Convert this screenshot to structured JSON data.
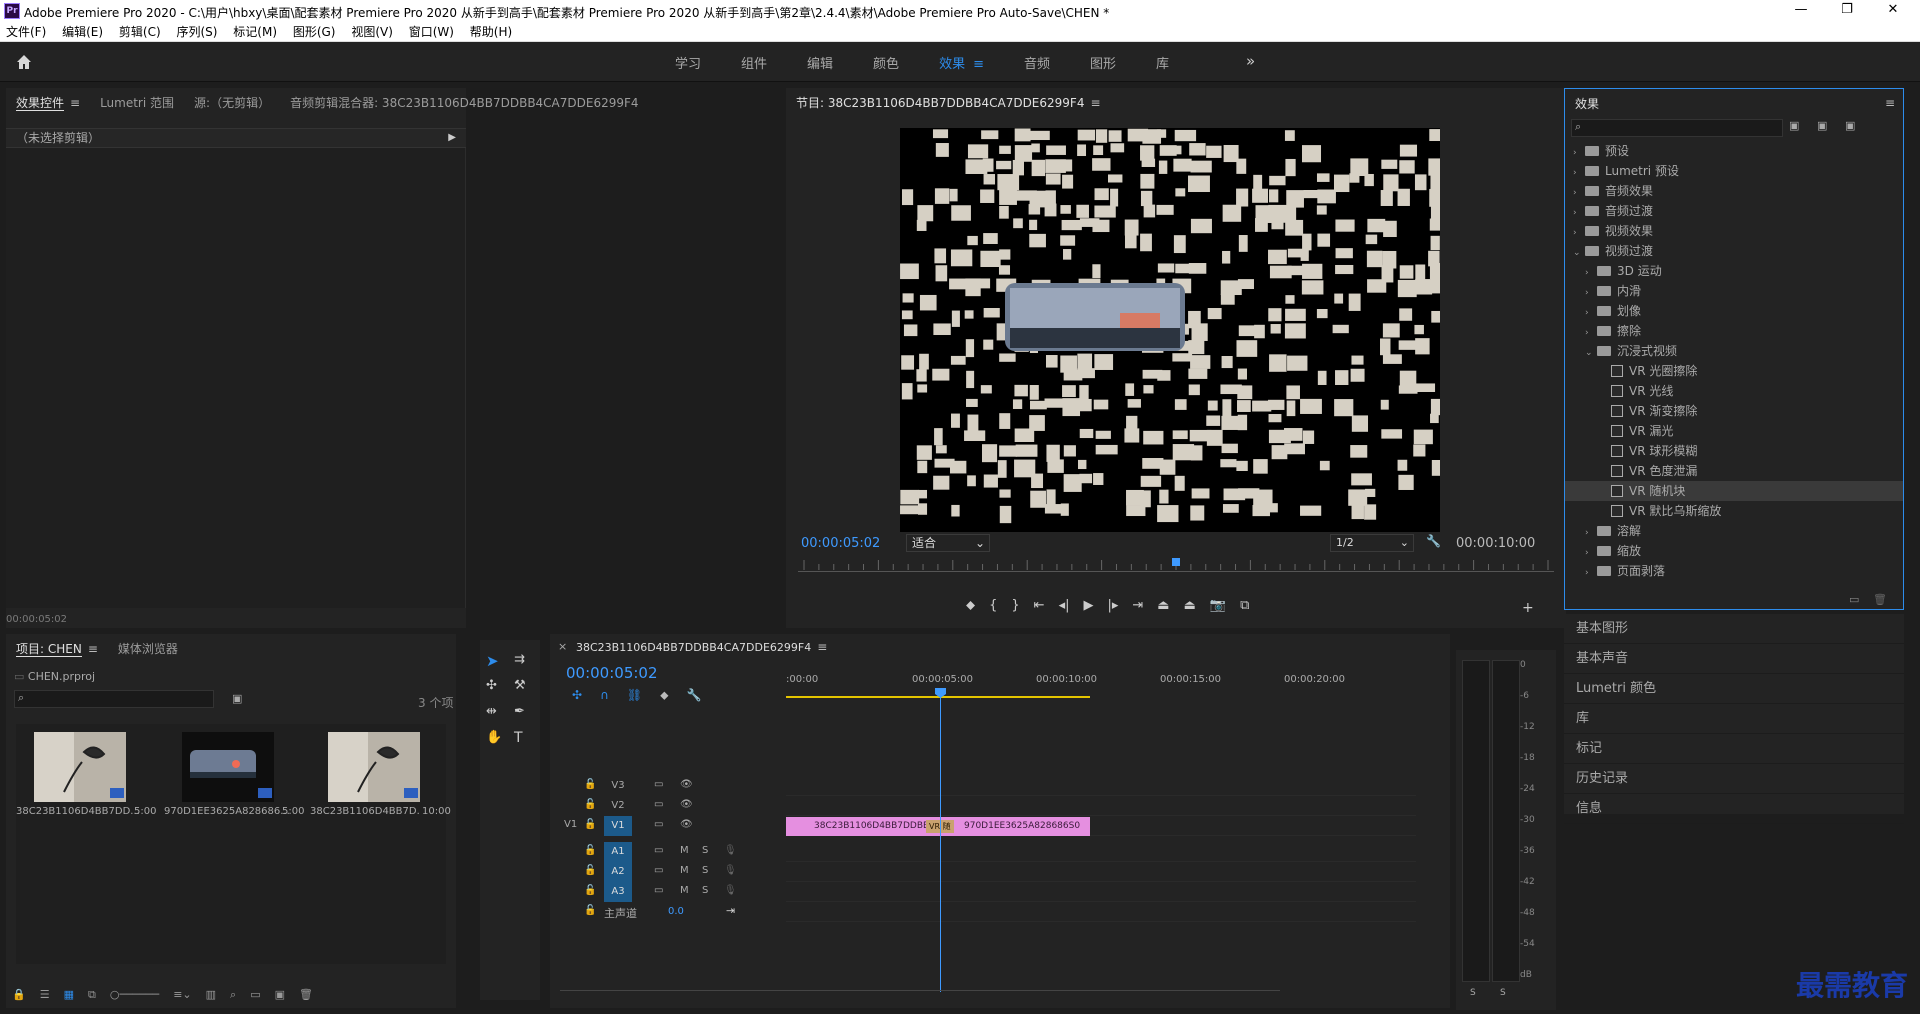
{
  "titlebar": {
    "app_icon": "Pr",
    "title": "Adobe Premiere Pro 2020 - C:\\用户\\hbxy\\桌面\\配套素材 Premiere Pro 2020 从新手到高手\\配套素材 Premiere Pro 2020 从新手到高手\\第2章\\2.4.4\\素材\\Adobe Premiere Pro Auto-Save\\CHEN *",
    "minimize": "—",
    "maximize": "❐",
    "close": "✕"
  },
  "menubar": [
    "文件(F)",
    "编辑(E)",
    "剪辑(C)",
    "序列(S)",
    "标记(M)",
    "图形(G)",
    "视图(V)",
    "窗口(W)",
    "帮助(H)"
  ],
  "workspaces": {
    "tabs": [
      "学习",
      "组件",
      "编辑",
      "颜色",
      "效果",
      "音频",
      "图形",
      "库"
    ],
    "active": "效果",
    "more": "»"
  },
  "effect_controls": {
    "tabs": [
      "效果控件",
      "Lumetri 范围",
      "源:（无剪辑）",
      "音频剪辑混合器: 38C23B1106D4BB7DDBB4CA7DDE6299F4"
    ],
    "no_clip": "（未选择剪辑）",
    "timecode": "00:00:05:02"
  },
  "program": {
    "title": "节目: 38C23B1106D4BB7DDBB4CA7DDE6299F4",
    "timecode": "00:00:05:02",
    "fit": "适合",
    "resolution": "1/2",
    "duration": "00:00:10:00",
    "playhead_fraction": 0.5
  },
  "effects_panel": {
    "title": "效果",
    "tree": [
      {
        "label": "预设",
        "level": 0,
        "type": "folder",
        "open": false
      },
      {
        "label": "Lumetri 预设",
        "level": 0,
        "type": "folder",
        "open": false
      },
      {
        "label": "音频效果",
        "level": 0,
        "type": "folder",
        "open": false
      },
      {
        "label": "音频过渡",
        "level": 0,
        "type": "folder",
        "open": false
      },
      {
        "label": "视频效果",
        "level": 0,
        "type": "folder",
        "open": false
      },
      {
        "label": "视频过渡",
        "level": 0,
        "type": "folder",
        "open": true
      },
      {
        "label": "3D 运动",
        "level": 1,
        "type": "folder",
        "open": false
      },
      {
        "label": "内滑",
        "level": 1,
        "type": "folder",
        "open": false
      },
      {
        "label": "划像",
        "level": 1,
        "type": "folder",
        "open": false
      },
      {
        "label": "擦除",
        "level": 1,
        "type": "folder",
        "open": false
      },
      {
        "label": "沉浸式视频",
        "level": 1,
        "type": "folder",
        "open": true
      },
      {
        "label": "VR 光圈擦除",
        "level": 2,
        "type": "effect"
      },
      {
        "label": "VR 光线",
        "level": 2,
        "type": "effect"
      },
      {
        "label": "VR 渐变擦除",
        "level": 2,
        "type": "effect"
      },
      {
        "label": "VR 漏光",
        "level": 2,
        "type": "effect"
      },
      {
        "label": "VR 球形模糊",
        "level": 2,
        "type": "effect"
      },
      {
        "label": "VR 色度泄漏",
        "level": 2,
        "type": "effect"
      },
      {
        "label": "VR 随机块",
        "level": 2,
        "type": "effect",
        "selected": true
      },
      {
        "label": "VR 默比乌斯缩放",
        "level": 2,
        "type": "effect"
      },
      {
        "label": "溶解",
        "level": 1,
        "type": "folder",
        "open": false
      },
      {
        "label": "缩放",
        "level": 1,
        "type": "folder",
        "open": false
      },
      {
        "label": "页面剥落",
        "level": 1,
        "type": "folder",
        "open": false
      }
    ]
  },
  "side_panels": [
    "基本图形",
    "基本声音",
    "Lumetri 颜色",
    "库",
    "标记",
    "历史记录",
    "信息"
  ],
  "project": {
    "tabs": [
      "项目: CHEN",
      "媒体浏览器"
    ],
    "file": "CHEN.prproj",
    "count": "3 个项",
    "items": [
      {
        "name": "38C23B1106D4BB7DD...",
        "duration": "5:00"
      },
      {
        "name": "970D1EE3625A828686...",
        "duration": "5:00"
      },
      {
        "name": "38C23B1106D4BB7D...",
        "duration": "10:00"
      }
    ]
  },
  "timeline": {
    "sequence": "38C23B1106D4BB7DDBB4CA7DDE6299F4",
    "timecode": "00:00:05:02",
    "ruler": [
      ":00:00",
      "00:00:05:00",
      "00:00:10:00",
      "00:00:15:00",
      "00:00:20:00"
    ],
    "video_tracks": [
      "V3",
      "V2",
      "V1"
    ],
    "audio_tracks": [
      "A1",
      "A2",
      "A3"
    ],
    "source_v1": "V1",
    "master": "主声道",
    "master_value": "0.0",
    "clips": [
      {
        "name": "38C23B1106D4BB7DDBB",
        "track": "V1"
      },
      {
        "name": "970D1EE3625A828686S0",
        "track": "V1"
      }
    ],
    "transition": "VR 随",
    "m_label": "M",
    "s_label": "S"
  },
  "meter": {
    "scale": [
      "0",
      "-6",
      "-12",
      "-18",
      "-24",
      "-30",
      "-36",
      "-42",
      "-48",
      "-54",
      "dB"
    ],
    "solo": [
      "S",
      "S"
    ]
  },
  "watermark": "最需教育",
  "colors": {
    "accent": "#2d8ceb",
    "clip": "#e58fe0",
    "timecode": "#3e9aff"
  }
}
